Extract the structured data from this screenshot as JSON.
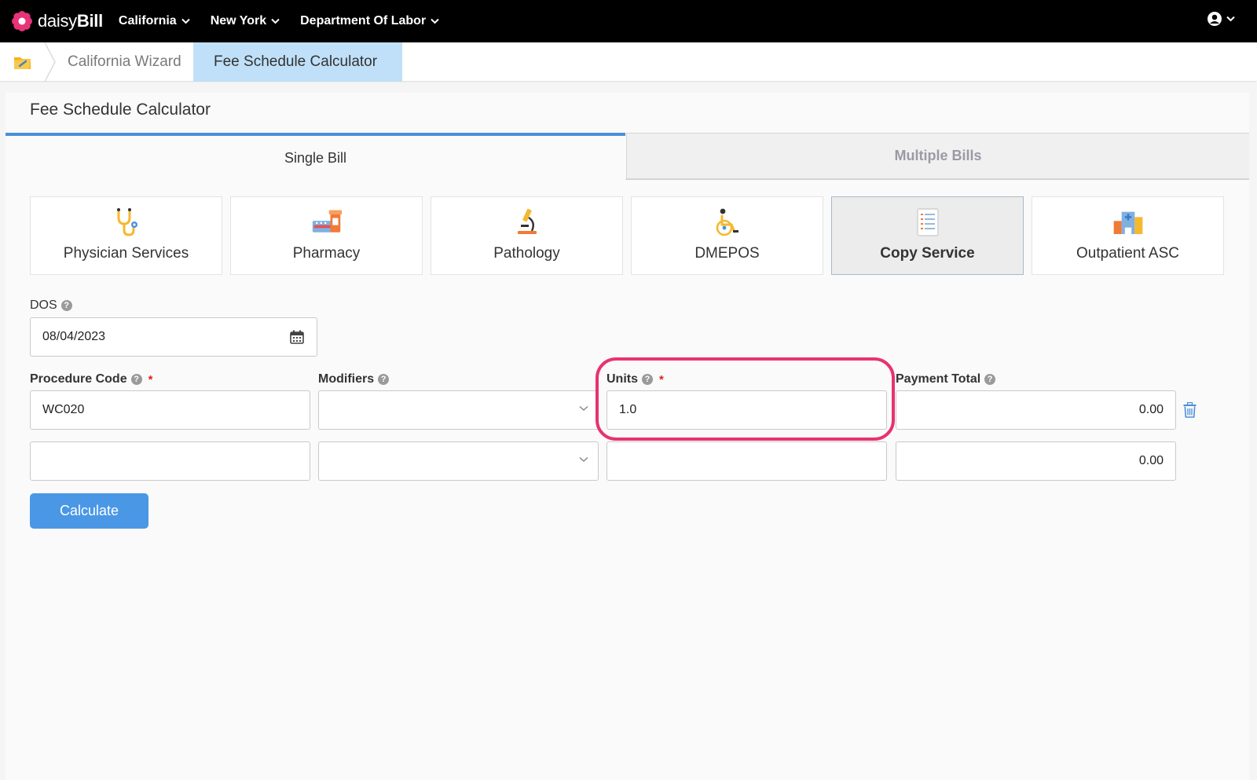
{
  "topbar": {
    "logo_prefix": "daisy",
    "logo_suffix": "Bill",
    "nav": [
      "California",
      "New York",
      "Department Of Labor"
    ]
  },
  "breadcrumb": {
    "wizard": "California Wizard",
    "current": "Fee Schedule Calculator"
  },
  "panel": {
    "title": "Fee Schedule Calculator",
    "tabs": [
      "Single Bill",
      "Multiple Bills"
    ]
  },
  "categories": [
    {
      "label": "Physician Services",
      "icon": "stethoscope-icon"
    },
    {
      "label": "Pharmacy",
      "icon": "pharmacy-icon"
    },
    {
      "label": "Pathology",
      "icon": "microscope-icon"
    },
    {
      "label": "DMEPOS",
      "icon": "wheelchair-icon"
    },
    {
      "label": "Copy Service",
      "icon": "document-icon",
      "selected": true
    },
    {
      "label": "Outpatient ASC",
      "icon": "hospital-icon"
    }
  ],
  "form": {
    "dos_label": "DOS",
    "dos_value": "08/04/2023",
    "procedure_label": "Procedure Code",
    "modifiers_label": "Modifiers",
    "units_label": "Units",
    "payment_label": "Payment Total",
    "required_mark": "*",
    "help_mark": "?",
    "rows": [
      {
        "procedure": "WC020",
        "modifier": "",
        "units": "1.0",
        "payment": "0.00"
      },
      {
        "procedure": "",
        "modifier": "",
        "units": "",
        "payment": "0.00"
      }
    ],
    "calculate_label": "Calculate"
  },
  "colors": {
    "accent": "#4a90d9",
    "highlight": "#e8336d",
    "active_crumb": "#bfe0f8"
  }
}
